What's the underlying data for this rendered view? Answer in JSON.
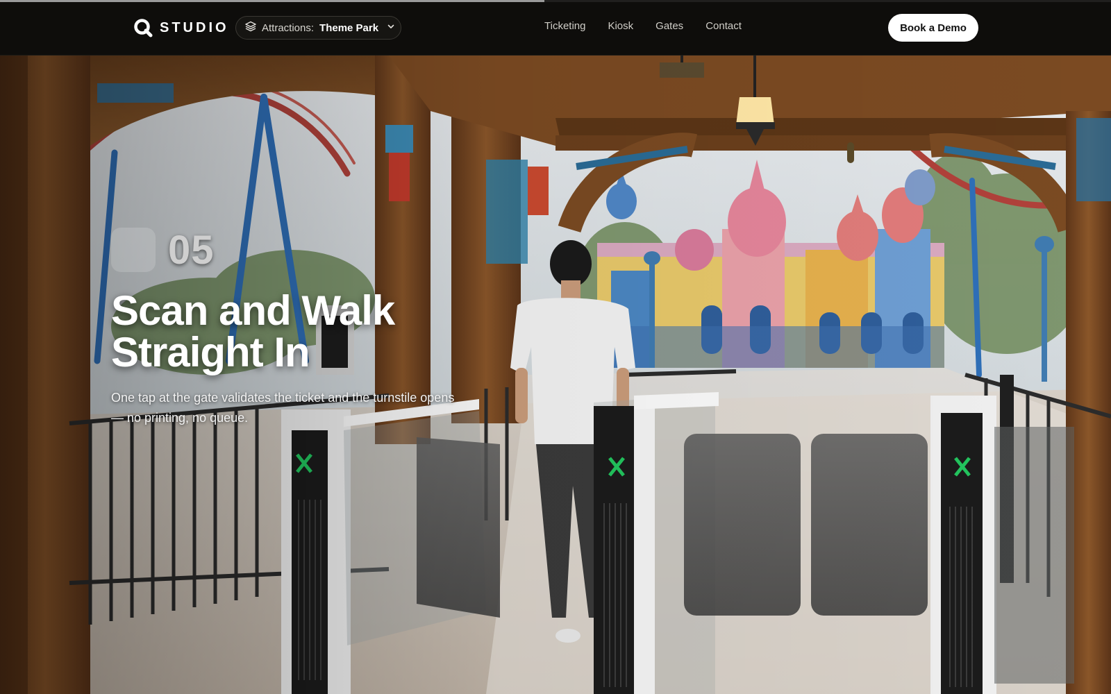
{
  "brand": {
    "name": "STUDIO",
    "logo_icon": "magnifier-q-icon"
  },
  "progress": {
    "fraction": 0.49
  },
  "selector": {
    "label": "Attractions:",
    "value": "Theme Park",
    "icon": "layers-icon",
    "chevron": "chevron-down-icon"
  },
  "nav": {
    "items": [
      "Ticketing",
      "Kiosk",
      "Gates",
      "Contact"
    ]
  },
  "cta": {
    "label": "Book a Demo"
  },
  "hero": {
    "index": "05",
    "title_line1": "Scan and Walk",
    "title_line2": "Straight In",
    "subtitle": "One tap at the gate validates the ticket and the turnstile opens — no printing, no queue."
  },
  "colors": {
    "nav_bg": "#0e0d0b",
    "cta_bg": "#ffffff",
    "gate_indicator": "#22c55e",
    "wood": "#7a4a24"
  }
}
